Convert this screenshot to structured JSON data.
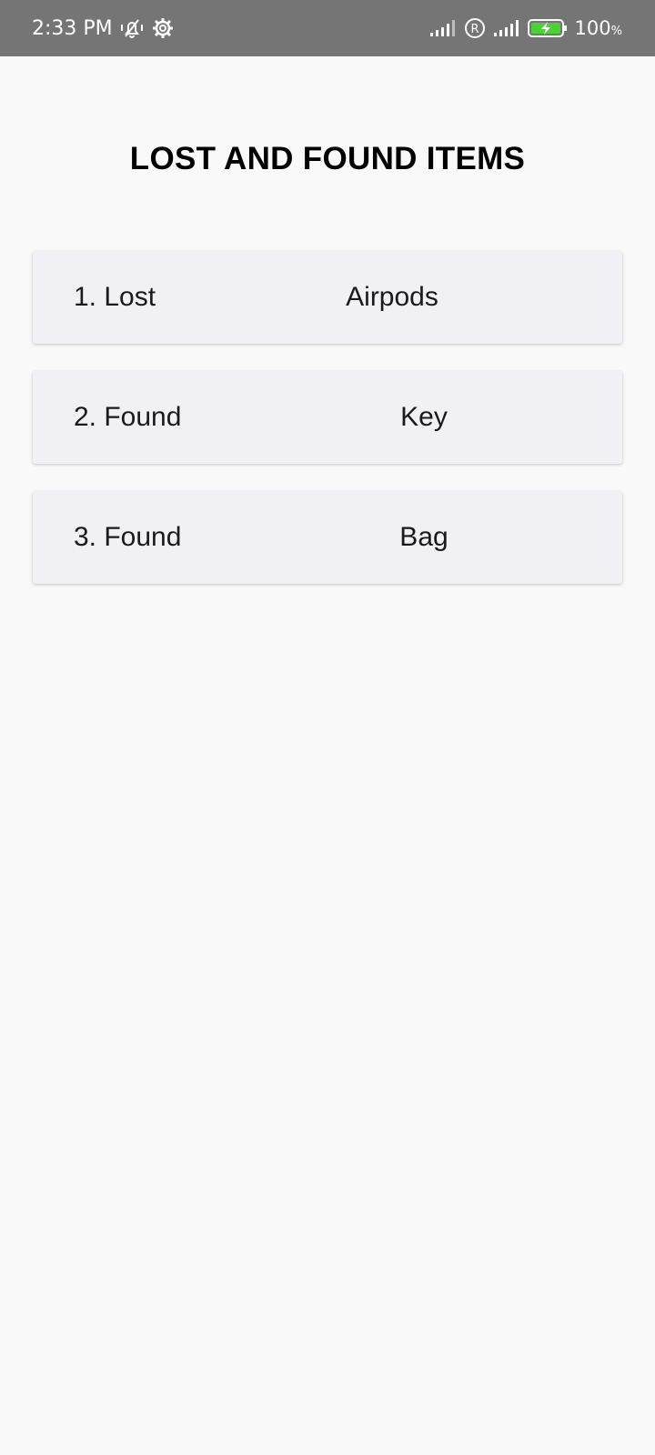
{
  "status_bar": {
    "time": "2:33 PM",
    "battery_percent": "100",
    "battery_unit": "%",
    "icons": [
      "vibrate-silent-icon",
      "settings-gear-icon",
      "signal-icon",
      "roaming-icon",
      "signal-icon",
      "battery-charging-icon"
    ]
  },
  "title": "LOST AND FOUND ITEMS",
  "items": [
    {
      "label": "1. Lost",
      "name": "Airpods"
    },
    {
      "label": "2. Found",
      "name": "Key"
    },
    {
      "label": "3. Found",
      "name": "Bag"
    }
  ],
  "colors": {
    "status_bar_bg": "#757575",
    "page_bg": "#f9f9f9",
    "card_bg": "#f1f0f5",
    "battery_fill": "#4cd137"
  }
}
